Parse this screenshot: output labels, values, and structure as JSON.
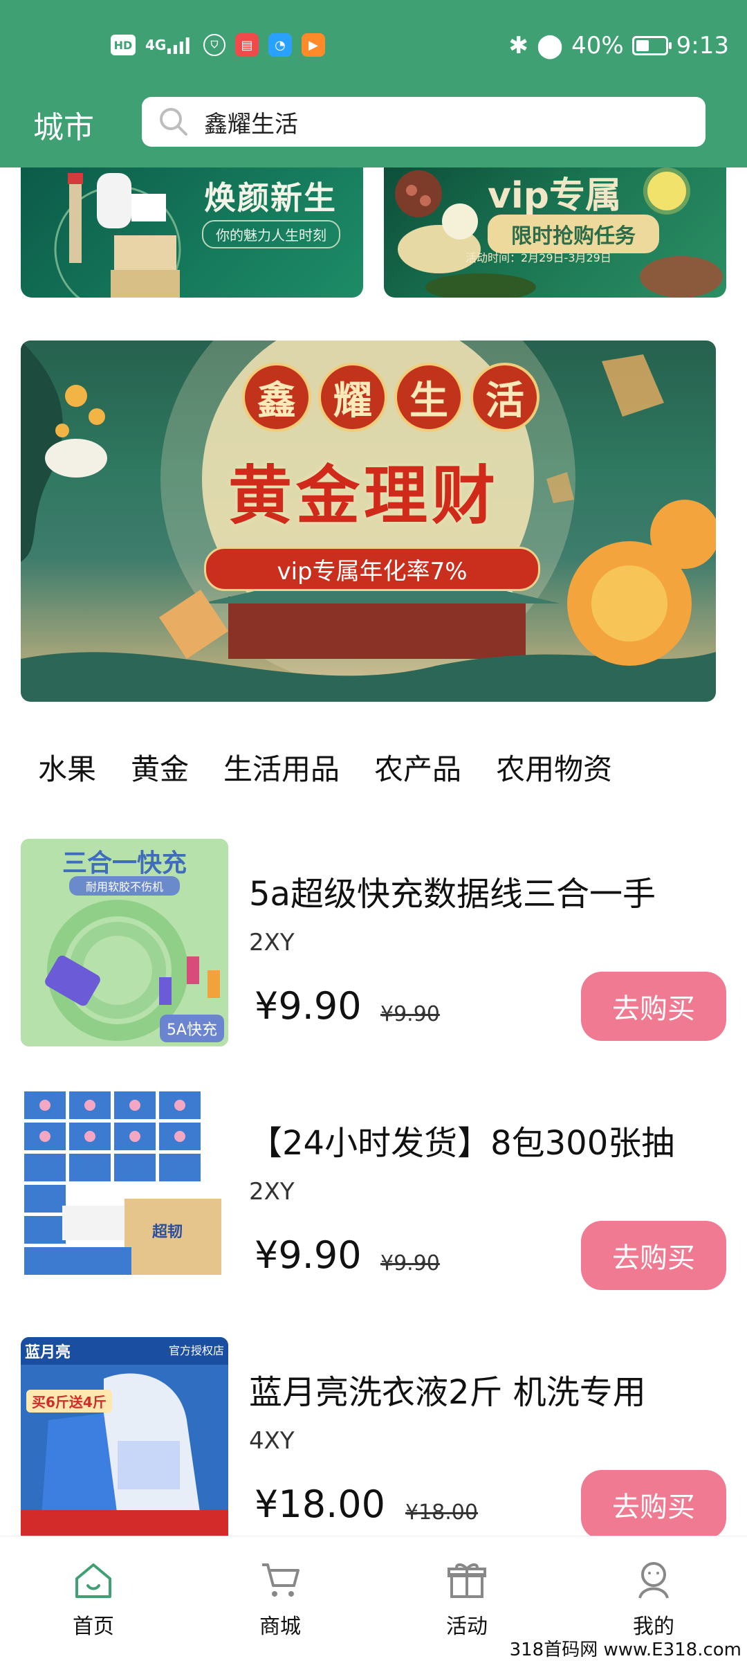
{
  "status_bar": {
    "left_icons": [
      "HD",
      "4G",
      "profile-app",
      "book-app",
      "chat-app",
      "video-app"
    ],
    "battery_percent": "40%",
    "time": "9:13"
  },
  "header": {
    "city": "城市",
    "search_text": "鑫耀生活",
    "bg_color": "#3fa173"
  },
  "promos": {
    "left": {
      "title": "焕颜新生",
      "subtitle": "你的魅力人生时刻"
    },
    "right": {
      "title": "vip专属",
      "tag": "限时抢购任务",
      "date": "活动时间：2月29日-3月29日"
    }
  },
  "hero": {
    "chars": [
      "鑫",
      "耀",
      "生",
      "活"
    ],
    "headline": "黄金理财",
    "pill": "vip专属年化率7%"
  },
  "categories": [
    "水果",
    "黄金",
    "生活用品",
    "农产品",
    "农用物资"
  ],
  "products": [
    {
      "name": "5a超级快充数据线三合一手",
      "store": "2XY",
      "price": "¥9.90",
      "original_price": "¥9.90",
      "buy_label": "去购买",
      "image_label": "三合一快充",
      "image_badge": "5A快充",
      "image_note": "耐用软胶不伤机"
    },
    {
      "name": "【24小时发货】8包300张抽",
      "store": "2XY",
      "price": "¥9.90",
      "original_price": "¥9.90",
      "buy_label": "去购买",
      "image_label": "超韧"
    },
    {
      "name": "蓝月亮洗衣液2斤 机洗专用",
      "store": "4XY",
      "price": "¥18.00",
      "original_price": "¥18.00",
      "buy_label": "去购买",
      "image_label": "蓝月亮",
      "image_badge": "官方授权店",
      "image_promo": "买6斤送4斤"
    }
  ],
  "bottom_nav": [
    {
      "label": "首页",
      "icon": "home-icon",
      "active": true
    },
    {
      "label": "商城",
      "icon": "cart-icon",
      "active": false
    },
    {
      "label": "活动",
      "icon": "gift-icon",
      "active": false
    },
    {
      "label": "我的",
      "icon": "profile-icon",
      "active": false
    }
  ],
  "watermark": "318首码网 www.E318.com",
  "colors": {
    "accent": "#3fa173",
    "buy_button": "#f07a91"
  }
}
